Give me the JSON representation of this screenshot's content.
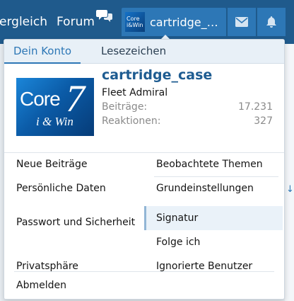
{
  "nav": {
    "vergleich_label": "ergleich",
    "forum_label": "Forum",
    "account_name": "cartridge_c…",
    "account_avatar_text": "Core i&Win"
  },
  "icons": {
    "chat": "chat-bubbles-icon",
    "inbox": "envelope-icon",
    "alerts": "bell-icon"
  },
  "colors": {
    "topbar": "#1f5a8c",
    "accent": "#2d77b6",
    "username": "#1e5c91"
  },
  "menu": {
    "tabs": [
      {
        "label": "Dein Konto",
        "active": true
      },
      {
        "label": "Lesezeichen",
        "active": false
      }
    ],
    "profile": {
      "avatar_core": "Core",
      "avatar_seven": "7",
      "avatar_sub": "i & Win",
      "username": "cartridge_case",
      "user_title": "Fleet Admiral",
      "stats": [
        {
          "label": "Beiträge:",
          "value": "17.231"
        },
        {
          "label": "Reaktionen:",
          "value": "327"
        }
      ]
    },
    "links_left": [
      "Neue Beiträge",
      "Persönliche Daten",
      "Passwort und Sicherheit",
      "Privatsphäre"
    ],
    "links_right": [
      "Beobachtete Themen",
      "Grundeinstellungen",
      "Signatur",
      "Folge ich",
      "Ignorierte Benutzer"
    ],
    "logout_label": "Abmelden"
  },
  "background": {
    "arrow_glyph": "↓"
  }
}
